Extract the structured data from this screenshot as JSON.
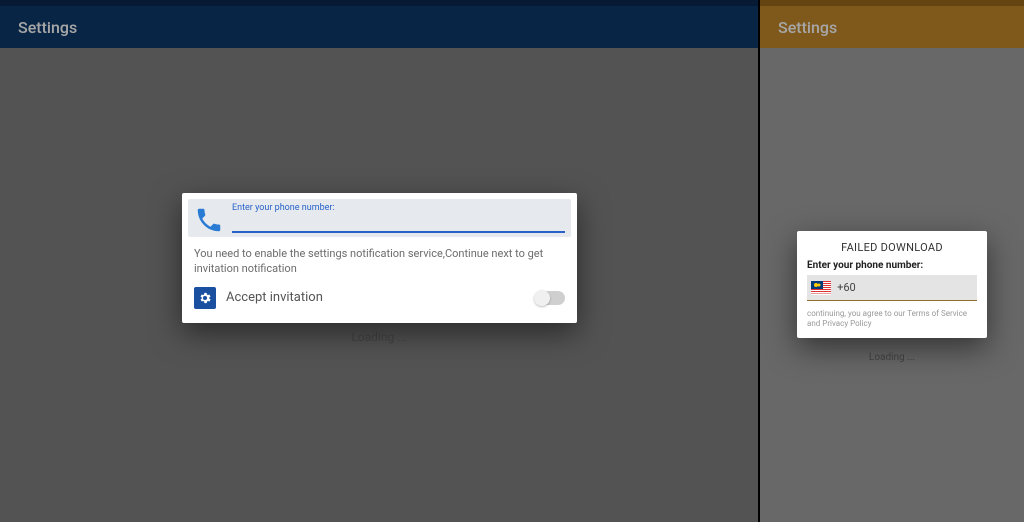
{
  "left": {
    "appbar_title": "Settings",
    "loading_text": "Loading ...",
    "dialog": {
      "phone_label": "Enter your phone number:",
      "phone_value": "",
      "helper_text": "You need to enable the settings notification service,Continue next to get invitation notification",
      "accept_label": "Accept invitation",
      "toggle_on": false
    }
  },
  "right": {
    "appbar_title": "Settings",
    "loading_text": "Loading ...",
    "dialog": {
      "title": "FAILED DOWNLOAD",
      "phone_label": "Enter your phone number:",
      "country_code": "+60",
      "country_flag": "malaysia-flag",
      "terms_text": "continuing, you agree to our Terms of Service and Privacy Policy"
    }
  }
}
